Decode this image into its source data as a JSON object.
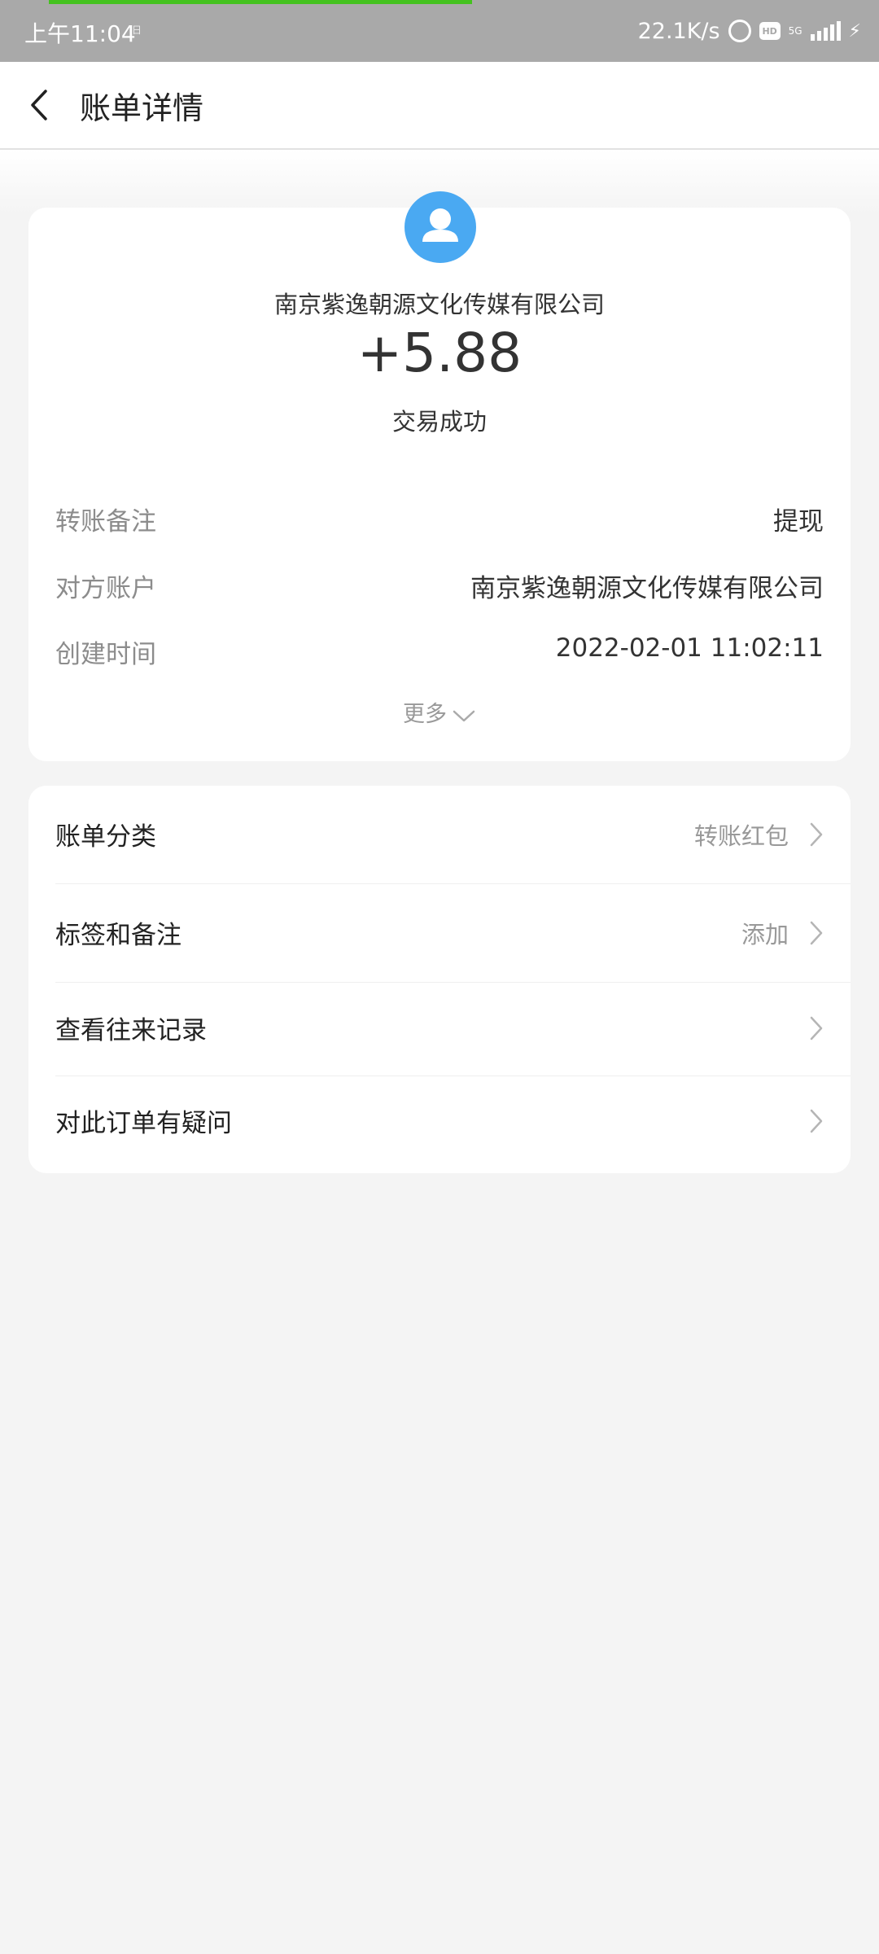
{
  "status_bar": {
    "time": "上午11:04",
    "mini": "日",
    "speed": "22.1K/s",
    "hd": "HD",
    "network": "5G"
  },
  "header": {
    "title": "账单详情"
  },
  "summary": {
    "payee": "南京紫逸朝源文化传媒有限公司",
    "amount": "+5.88",
    "status": "交易成功",
    "avatar_color": "#4aa9f2"
  },
  "details": [
    {
      "label": "转账备注",
      "value": "提现"
    },
    {
      "label": "对方账户",
      "value": "南京紫逸朝源文化传媒有限公司"
    },
    {
      "label": "创建时间",
      "value": "2022-02-01 11:02:11"
    }
  ],
  "more_label": "更多",
  "list": [
    {
      "label": "账单分类",
      "value": "转账红包"
    },
    {
      "label": "标签和备注",
      "value": "添加"
    },
    {
      "label": "查看往来记录",
      "value": ""
    },
    {
      "label": "对此订单有疑问",
      "value": ""
    }
  ]
}
